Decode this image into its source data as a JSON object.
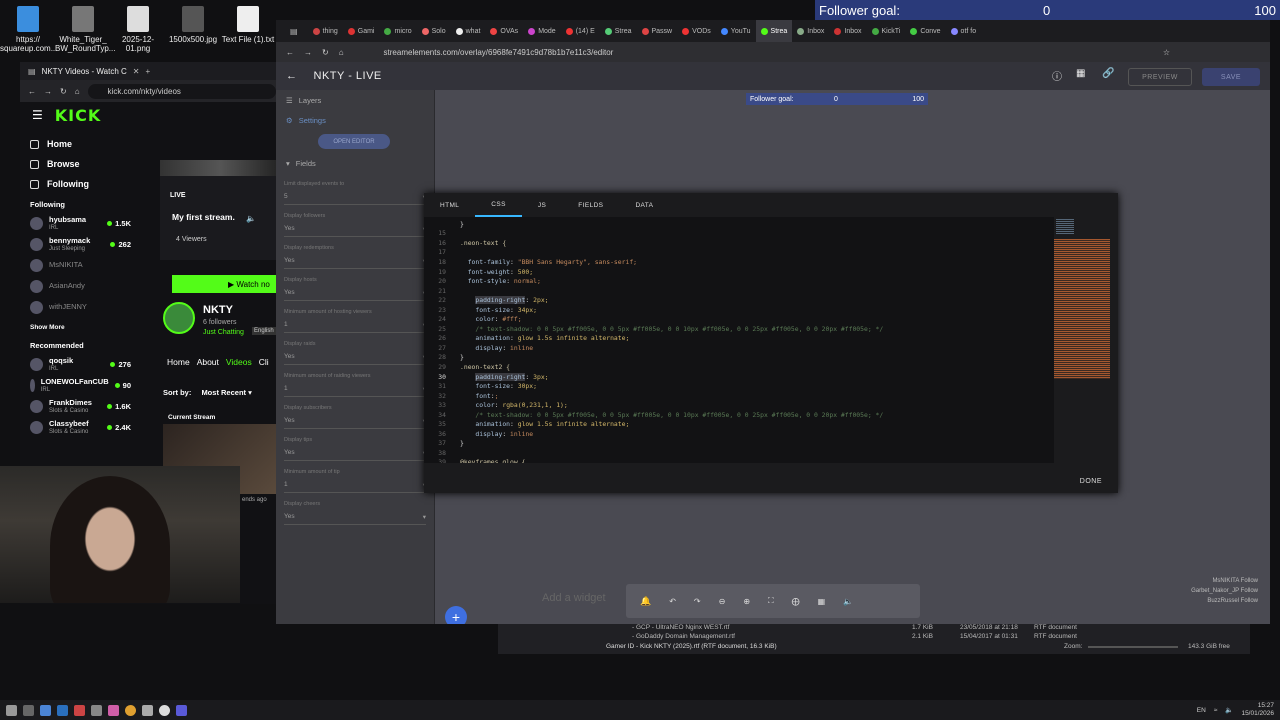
{
  "desktop": {
    "icons": [
      {
        "label": "https://\nsquareup.com...",
        "color": "#3b8ede"
      },
      {
        "label": "White_Tiger_\nBW_RoundTyp...",
        "color": "#777"
      },
      {
        "label": "2025-12-01.png",
        "color": "#ddd"
      },
      {
        "label": "1500x500.jpg",
        "color": "#555"
      },
      {
        "label": "Text File (1).txt",
        "color": "#eee"
      }
    ]
  },
  "follower_widget_top": {
    "label": "Follower goal:",
    "current": "0",
    "target": "100",
    "accent": "#2a3a7a"
  },
  "kick": {
    "tab_title": "NKTY Videos - Watch C",
    "url": "kick.com/nkty/videos",
    "logo": "KICK",
    "nav": [
      {
        "label": "Home",
        "icon": "home-icon"
      },
      {
        "label": "Browse",
        "icon": "browse-icon"
      },
      {
        "label": "Following",
        "icon": "heart-icon"
      }
    ],
    "following_title": "Following",
    "following": [
      {
        "name": "hyubsama",
        "sub": "IRL",
        "count": "1.5K"
      },
      {
        "name": "bennymack",
        "sub": "Just Sleeping",
        "count": "262"
      },
      {
        "name": "MsNIKITA",
        "sub": "",
        "count": ""
      },
      {
        "name": "AsianAndy",
        "sub": "",
        "count": ""
      },
      {
        "name": "withJENNY",
        "sub": "",
        "count": ""
      }
    ],
    "show_more": "Show More",
    "recommended_title": "Recommended",
    "recommended": [
      {
        "name": "qoqsik",
        "sub": "IRL",
        "count": "276"
      },
      {
        "name": "LONEWOLFanCUB",
        "sub": "IRL",
        "count": "90"
      },
      {
        "name": "FrankDimes",
        "sub": "Slots & Casino",
        "count": "1.6K"
      },
      {
        "name": "Classybeef",
        "sub": "Slots & Casino",
        "count": "2.4K"
      }
    ],
    "live_badge": "LIVE",
    "stream_title": "My first stream.",
    "viewers": "4 Viewers",
    "watch_button": "Watch no",
    "channel_name": "NKTY",
    "followers": "6 followers",
    "category": "Just Chatting",
    "language": "English",
    "channel_tabs": [
      "Home",
      "About",
      "Videos",
      "Cli"
    ],
    "sort_label": "Sort by:",
    "sort_value": "Most Recent",
    "current_stream": "Current Stream",
    "ago": "ends ago",
    "brand_color": "#53fc18"
  },
  "browser": {
    "tabs": [
      "thing",
      "Gami",
      "micro",
      "Solo",
      "what",
      "OVAs",
      "Mode",
      "(14) E",
      "Strea",
      "Passw",
      "VODs",
      "YouTu",
      "Strea",
      "Inbox",
      "Inbox",
      "KickTi",
      "Conve",
      "otf fo"
    ],
    "url": "streamelements.com/overlay/6968fe7491c9d78b1b7e11c3/editor"
  },
  "editor": {
    "title": "NKTY - LIVE",
    "preview": "PREVIEW",
    "save": "SAVE",
    "sidebar": {
      "layers": "Layers",
      "settings": "Settings",
      "open_editor": "OPEN EDITOR",
      "fields": "Fields",
      "field_rows": [
        {
          "label": "Limit displayed events to",
          "value": "5"
        },
        {
          "label": "Display followers",
          "value": "Yes"
        },
        {
          "label": "Display redemptions",
          "value": "Yes"
        },
        {
          "label": "Display hosts",
          "value": "Yes"
        },
        {
          "label": "Minimum amount of hosting viewers",
          "value": "1"
        },
        {
          "label": "Display raids",
          "value": "Yes"
        },
        {
          "label": "Minimum amount of raiding viewers",
          "value": "1"
        },
        {
          "label": "Display subscribers",
          "value": "Yes"
        },
        {
          "label": "Display tips",
          "value": "Yes"
        },
        {
          "label": "Minimum amount of tip",
          "value": "1"
        },
        {
          "label": "Display cheers",
          "value": "Yes"
        }
      ]
    },
    "widget": {
      "label": "Follower goal:",
      "current": "0",
      "target": "100"
    },
    "modal_tabs": [
      "HTML",
      "CSS",
      "JS",
      "FIELDS",
      "DATA"
    ],
    "active_tab": "CSS",
    "done": "DONE",
    "code_lines": [
      {
        "n": "",
        "t": "}"
      },
      {
        "n": "15",
        "t": ""
      },
      {
        "n": "16",
        "t": ".neon-text {"
      },
      {
        "n": "17",
        "t": ""
      },
      {
        "n": "18",
        "t": "  font-family: \"BBH Sans Hegarty\", sans-serif;"
      },
      {
        "n": "19",
        "t": "  font-weight: 500;"
      },
      {
        "n": "20",
        "t": "  font-style: normal;"
      },
      {
        "n": "21",
        "t": ""
      },
      {
        "n": "22",
        "t": "    padding-right: 2px;"
      },
      {
        "n": "23",
        "t": "    font-size: 34px;"
      },
      {
        "n": "24",
        "t": "    color: #fff;"
      },
      {
        "n": "25",
        "t": "    /* text-shadow: 0 0 5px #ff005e, 0 0 5px #ff005e, 0 0 10px #ff005e, 0 0 25px #ff005e, 0 0 20px #ff005e; */"
      },
      {
        "n": "26",
        "t": "    animation: glow 1.5s infinite alternate;"
      },
      {
        "n": "27",
        "t": "    display: inline"
      },
      {
        "n": "28",
        "t": "}"
      },
      {
        "n": "29",
        "t": ".neon-text2 {"
      },
      {
        "n": "30",
        "t": "    padding-right: 3px;"
      },
      {
        "n": "31",
        "t": "    font-size: 30px;"
      },
      {
        "n": "32",
        "t": "    font:;"
      },
      {
        "n": "33",
        "t": "    color: rgba(0,231,1, 1);"
      },
      {
        "n": "34",
        "t": "    /* text-shadow: 0 0 5px #ff005e, 0 0 5px #ff005e, 0 0 10px #ff005e, 0 0 25px #ff005e, 0 0 20px #ff005e; */"
      },
      {
        "n": "35",
        "t": "    animation: glow 1.5s infinite alternate;"
      },
      {
        "n": "36",
        "t": "    display: inline"
      },
      {
        "n": "37",
        "t": "}"
      },
      {
        "n": "38",
        "t": ""
      },
      {
        "n": "39",
        "t": "@keyframes glow {"
      },
      {
        "n": "40",
        "t": "    0% {"
      }
    ],
    "current_line": "30",
    "toolbar_label": "Add a widget",
    "activity": [
      "MsNIKITA  Follow",
      "Garbet_Nakor_JP  Follow",
      "BuzzRussel  Follow"
    ]
  },
  "filemanager": {
    "rows": [
      {
        "name": "- GCP - UltraNEO Nginx WEST.rtf",
        "size": "1.7 KiB",
        "date": "23/05/2018 at 21:18",
        "type": "RTF document"
      },
      {
        "name": "- GoDaddy Domain Management.rtf",
        "size": "2.1 KiB",
        "date": "15/04/2017 at 01:31",
        "type": "RTF document"
      }
    ],
    "status": "Gamer ID - Kick NKTY (2025).rtf (RTF document, 16.3 KiB)",
    "zoom_label": "Zoom:",
    "free": "143.3 GiB free"
  },
  "taskbar": {
    "clock": "15:27",
    "date": "15/01/2026",
    "lang": "EN"
  }
}
